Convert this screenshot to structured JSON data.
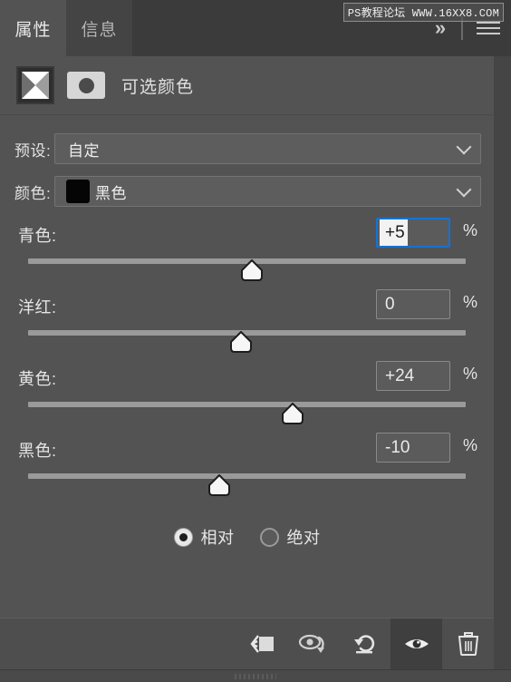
{
  "watermark": {
    "text": "PS教程论坛 WWW.16XX8.COM"
  },
  "tabs": [
    {
      "label": "属性",
      "active": true
    },
    {
      "label": "信息",
      "active": false
    }
  ],
  "header": {
    "collapse_label": "»",
    "adjustment_title": "可选颜色",
    "adjustment_thumb_icon": "selective-color-thumbnail",
    "mask_thumb_icon": "layer-mask-thumbnail",
    "menu_icon": "hamburger-menu-icon"
  },
  "fields": {
    "preset": {
      "label": "预设:",
      "value": "自定",
      "chevron_icon": "chevron-down-icon"
    },
    "color": {
      "label": "颜色:",
      "value": "黑色",
      "swatch_color": "#050505",
      "chevron_icon": "chevron-down-icon"
    }
  },
  "sliders": [
    {
      "name": "cyan",
      "label": "青色:",
      "value": "+5",
      "unit": "%",
      "percent": 49,
      "focused": true
    },
    {
      "name": "magenta",
      "label": "洋红:",
      "value": "0",
      "unit": "%",
      "percent": 46,
      "focused": false
    },
    {
      "name": "yellow",
      "label": "黄色:",
      "value": "+24",
      "unit": "%",
      "percent": 58,
      "focused": false
    },
    {
      "name": "black",
      "label": "黑色:",
      "value": "-10",
      "unit": "%",
      "percent": 41,
      "focused": false
    }
  ],
  "method": {
    "options": [
      {
        "label": "相对",
        "selected": true
      },
      {
        "label": "绝对",
        "selected": false
      }
    ]
  },
  "footer": {
    "buttons": [
      {
        "icon": "clip-to-layer-icon",
        "active": false
      },
      {
        "icon": "preview-previous-state-icon",
        "active": false
      },
      {
        "icon": "reset-icon",
        "active": false
      },
      {
        "icon": "toggle-visibility-eye-icon",
        "active": true
      },
      {
        "icon": "delete-trash-icon",
        "active": false
      }
    ]
  },
  "colors": {
    "panel_bg": "#535353",
    "tabbar_bg": "#3b3b3b",
    "footer_bg": "#4e4e4e",
    "focus_blue": "#1473d8",
    "track": "#9a9a9a",
    "text": "#e5e5e5"
  }
}
